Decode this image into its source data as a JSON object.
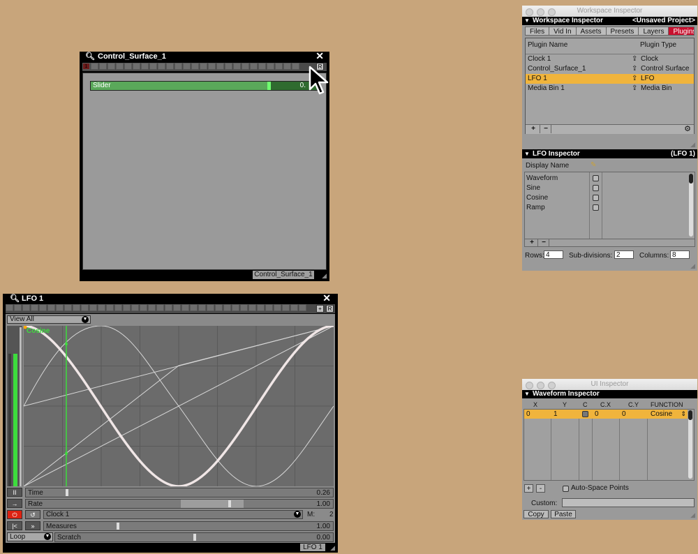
{
  "control_surface": {
    "title": "Control_Surface_1",
    "r_label": "R",
    "cell_one": "1",
    "slider_label": "Slider",
    "slider_value": "0.",
    "slider_level": 0.78,
    "footer": "Control_Surface_1"
  },
  "lfo": {
    "title": "LFO 1",
    "plus_label": "+",
    "r_label": "R",
    "view_select": "View All",
    "curve_label": "Cosine",
    "rows": [
      {
        "label": "Time",
        "value": "0.26"
      },
      {
        "label": "Rate",
        "value": "1.00"
      },
      {
        "label": "Measures",
        "value": "1.00"
      },
      {
        "label": "Scratch",
        "value": "0.00"
      }
    ],
    "clock_select": "Clock 1",
    "m_label": "M:",
    "m_value": "2",
    "loop_select": "Loop",
    "footer": "LFO 1",
    "pause_icon": "II",
    "arrow_icon": "→",
    "rewind_icon": "K",
    "ff_icon": "»",
    "accent_green": "#3ddc3d"
  },
  "workspace": {
    "window_title": "Workspace Inspector",
    "header": "Workspace Inspector",
    "project": "<Unsaved Project>",
    "tabs": [
      "Files",
      "Vid In",
      "Assets",
      "Presets",
      "Layers",
      "Plugins"
    ],
    "active_tab": "Plugins",
    "col_name": "Plugin Name",
    "col_type": "Plugin Type",
    "plugins": [
      {
        "name": "Clock 1",
        "type": "Clock"
      },
      {
        "name": "Control_Surface_1",
        "type": "Control Surface"
      },
      {
        "name": "LFO 1",
        "type": "LFO"
      },
      {
        "name": "Media Bin 1",
        "type": "Media Bin"
      }
    ],
    "selected_row": 2,
    "add_label": "+",
    "remove_label": "−"
  },
  "lfo_inspector": {
    "header": "LFO Inspector",
    "header_right": "(LFO 1)",
    "display_name": "Display Name",
    "items": [
      "Waveform",
      "Sine",
      "Cosine",
      "Ramp"
    ],
    "rows_label": "Rows:",
    "rows_value": "4",
    "subdiv_label": "Sub-divisions:",
    "subdiv_value": "2",
    "cols_label": "Columns:",
    "cols_value": "8",
    "add_label": "+",
    "remove_label": "−"
  },
  "ui_inspector": {
    "window_title": "UI Inspector",
    "header": "Waveform Inspector",
    "columns": [
      "X",
      "Y",
      "C",
      "C.X",
      "C.Y",
      "FUNCTION"
    ],
    "row": {
      "x": "0",
      "y": "1",
      "cx": "0",
      "cy": "0",
      "function": "Cosine"
    },
    "plus_label": "+",
    "minus_label": "-",
    "auto_space": "Auto-Space Points",
    "custom_label": "Custom:",
    "copy_label": "Copy",
    "paste_label": "Paste"
  }
}
